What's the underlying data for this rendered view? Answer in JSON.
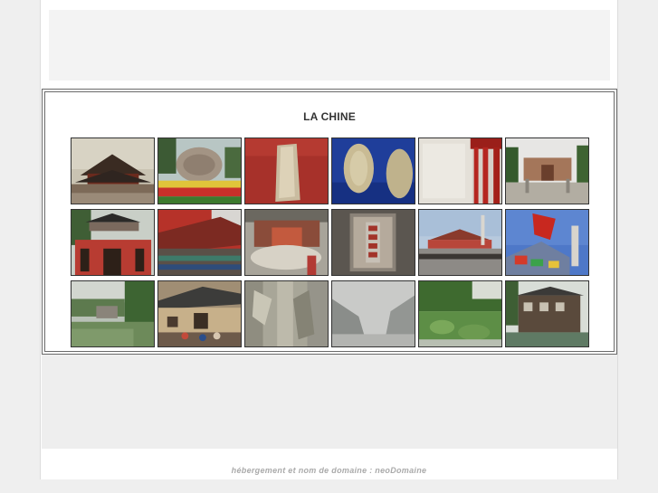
{
  "gallery": {
    "title": "LA CHINE",
    "photos": [
      {
        "name": "photo-pagoda-roof"
      },
      {
        "name": "photo-carved-stone-flowers"
      },
      {
        "name": "photo-bone-artifact-red"
      },
      {
        "name": "photo-oracle-bones-blue"
      },
      {
        "name": "photo-red-colonnade"
      },
      {
        "name": "photo-temple-courtyard"
      },
      {
        "name": "photo-red-gate"
      },
      {
        "name": "photo-temple-eaves"
      },
      {
        "name": "photo-temple-incense"
      },
      {
        "name": "photo-stone-stele"
      },
      {
        "name": "photo-tiananmen-square"
      },
      {
        "name": "photo-dragon-boat-flag"
      },
      {
        "name": "photo-village-lake"
      },
      {
        "name": "photo-old-house-crowd"
      },
      {
        "name": "photo-carved-stone-texture"
      },
      {
        "name": "photo-misty-gorge"
      },
      {
        "name": "photo-lotus-pond"
      },
      {
        "name": "photo-wooden-waterhouse"
      }
    ]
  },
  "footer": {
    "text": "hébergement et nom de domaine : neoDomaine"
  }
}
